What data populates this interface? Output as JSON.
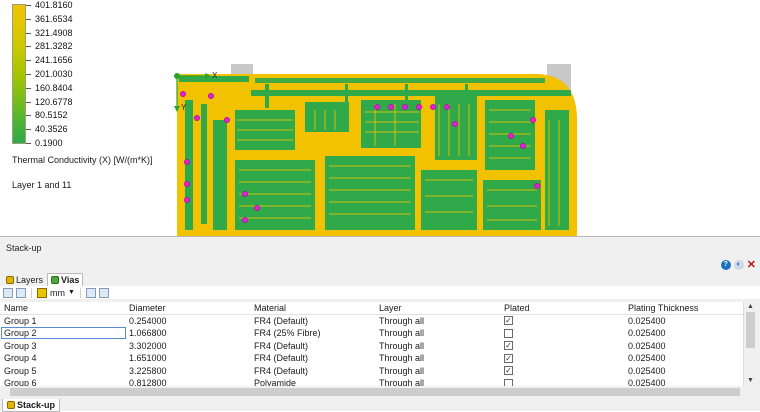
{
  "legend": {
    "ticks": [
      "401.8160",
      "361.6534",
      "321.4908",
      "281.3282",
      "241.1656",
      "201.0030",
      "160.8404",
      "120.6778",
      "80.5152",
      "40.3526",
      "0.1900"
    ],
    "title": "Thermal Conductivity (X) [W/(m*K)]",
    "layers": "Layer 1 and 11"
  },
  "axes": {
    "x": "X",
    "y": "Y"
  },
  "colors": {
    "board_yellow": "#f2c200",
    "copper_green": "#2fa94a",
    "via_magenta": "#e01fd0",
    "selection_blue": "#5c8bd6"
  },
  "panel": {
    "title": "Stack-up",
    "tabs": [
      {
        "label": "Layers",
        "icon": "layers-icon"
      },
      {
        "label": "Vias",
        "icon": "vias-icon"
      }
    ],
    "unit": "mm",
    "columns": [
      "Name",
      "Diameter",
      "Material",
      "Layer",
      "Plated",
      "Plating Thickness"
    ],
    "rows": [
      {
        "name": "Group 1",
        "diameter": "0.254000",
        "material": "FR4 (Default)",
        "layer": "Through all",
        "plated": true,
        "thickness": "0.025400"
      },
      {
        "name": "Group 2",
        "diameter": "1.066800",
        "material": "FR4 (25% Fibre)",
        "layer": "Through all",
        "plated": false,
        "thickness": "0.025400"
      },
      {
        "name": "Group 3",
        "diameter": "3.302000",
        "material": "FR4 (Default)",
        "layer": "Through all",
        "plated": true,
        "thickness": "0.025400"
      },
      {
        "name": "Group 4",
        "diameter": "1.651000",
        "material": "FR4 (Default)",
        "layer": "Through all",
        "plated": true,
        "thickness": "0.025400"
      },
      {
        "name": "Group 5",
        "diameter": "3.225800",
        "material": "FR4 (Default)",
        "layer": "Through all",
        "plated": true,
        "thickness": "0.025400"
      },
      {
        "name": "Group 6",
        "diameter": "0.812800",
        "material": "Polyamide",
        "layer": "Through all",
        "plated": false,
        "thickness": "0.025400"
      }
    ],
    "bottom_tab": "Stack-up"
  }
}
